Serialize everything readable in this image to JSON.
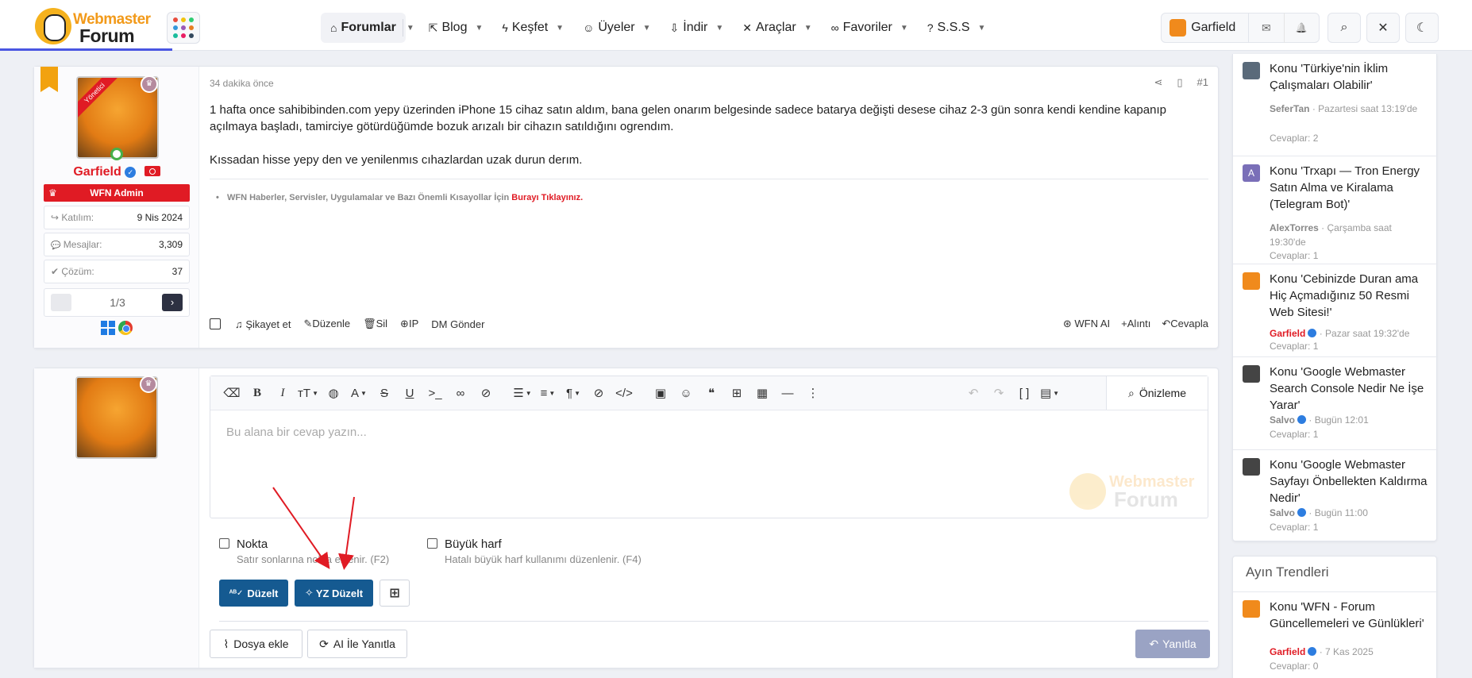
{
  "header": {
    "logo_top": "Webmaster",
    "logo_bottom": "Forum",
    "nav": [
      {
        "label": "Forumlar",
        "icon": "⌂",
        "active": true
      },
      {
        "label": "Blog",
        "icon": "⇱"
      },
      {
        "label": "Keşfet",
        "icon": "ϟ"
      },
      {
        "label": "Üyeler",
        "icon": "☺"
      },
      {
        "label": "İndir",
        "icon": "⇩"
      },
      {
        "label": "Araçlar",
        "icon": "✕"
      },
      {
        "label": "Favoriler",
        "icon": "∞"
      },
      {
        "label": "S.S.S",
        "icon": "?"
      }
    ],
    "user_name": "Garfield",
    "icons": {
      "mail": "✉",
      "bell": "🔔",
      "search": "⌕",
      "tools": "✕",
      "theme": "☾"
    }
  },
  "post": {
    "badge_label": "Yönetici",
    "username": "Garfield",
    "role": "WFN Admin",
    "stats": [
      {
        "label": "Katılım:",
        "value": "9 Nis 2024",
        "icon": "↪"
      },
      {
        "label": "Mesajlar:",
        "value": "3,309",
        "icon": "💬"
      },
      {
        "label": "Çözüm:",
        "value": "37",
        "icon": "✔"
      }
    ],
    "pager": "1/3",
    "time": "34 dakika önce",
    "number": "#1",
    "paragraphs": [
      "1 hafta once sahibibinden.com yepy üzerinden iPhone 15 cihaz satın aldım, bana gelen onarım belgesinde sadece batarya değişti desese cihaz 2-3 gün sonra kendi kendine kapanıp açılmaya başladı, tamirciye götürdüğümde bozuk arızalı bir cihazın satıldığını ogrendım.",
      "Kıssadan hisse yepy den ve yenilenmıs cıhazlardan uzak durun derım."
    ],
    "signature_text": "WFN Haberler, Servisler, Uygulamalar ve Bazı Önemli Kısayollar İçin",
    "signature_link": "Burayı Tıklayınız.",
    "actions": [
      "Şikayet et",
      "Düzenle",
      "Sil",
      "IP",
      "DM Gönder"
    ],
    "actions_right": [
      "WFN AI",
      "Alıntı",
      "Cevapla"
    ]
  },
  "reply": {
    "placeholder": "Bu alana bir cevap yazın...",
    "preview": "Önizleme",
    "options": [
      {
        "label": "Nokta",
        "desc": "Satır sonlarına nokta eklenir. (F2)"
      },
      {
        "label": "Büyük harf",
        "desc": "Hatalı büyük harf kullanımı düzenlenir. (F4)"
      }
    ],
    "fix_btn": "Düzelt",
    "ai_fix_btn": "YZ Düzelt",
    "attach_btn": "Dosya ekle",
    "ai_reply_btn": "AI İle Yanıtla",
    "send_btn": "Yanıtla"
  },
  "sidebar": {
    "items": [
      {
        "title": "Konu 'Türkiye'nin İklim Çalışmaları Olabilir'",
        "user": "SeferTan",
        "date": "· Pazartesi saat 13:19'de",
        "replies": "Cevaplar: 2",
        "color": "#5a6a7a"
      },
      {
        "title": "Konu 'Trxapı — Tron Energy Satın Alma ve Kiralama (Telegram Bot)'",
        "user": "AlexTorres",
        "date": "· Çarşamba saat 19:30'de",
        "replies": "Cevaplar: 1",
        "color": "#7a6fb8",
        "letter": "A"
      },
      {
        "title": "Konu 'Cebinizde Duran ama Hiç Açmadığınız 50 Resmi Web Sitesi!'",
        "user": "Garfield",
        "date": "· Pazar saat 19:32'de",
        "replies": "Cevaplar: 1",
        "color": "#f08a1c",
        "red": true
      },
      {
        "title": "Konu 'Google Webmaster Search Console Nedir Ne İşe Yarar'",
        "user": "Salvo",
        "date": "· Bugün 12:01",
        "replies": "Cevaplar: 1",
        "color": "#444"
      },
      {
        "title": "Konu 'Google Webmaster Sayfayı Önbellekten Kaldırma Nedir'",
        "user": "Salvo",
        "date": "· Bugün 11:00",
        "replies": "Cevaplar: 1",
        "color": "#444"
      }
    ],
    "trend_title": "Ayın Trendleri",
    "trend_item": {
      "title": "Konu 'WFN - Forum Güncellemeleri ve Günlükleri'",
      "user": "Garfield",
      "date": "· 7 Kas 2025",
      "replies": "Cevaplar: 0",
      "color": "#f08a1c"
    }
  }
}
